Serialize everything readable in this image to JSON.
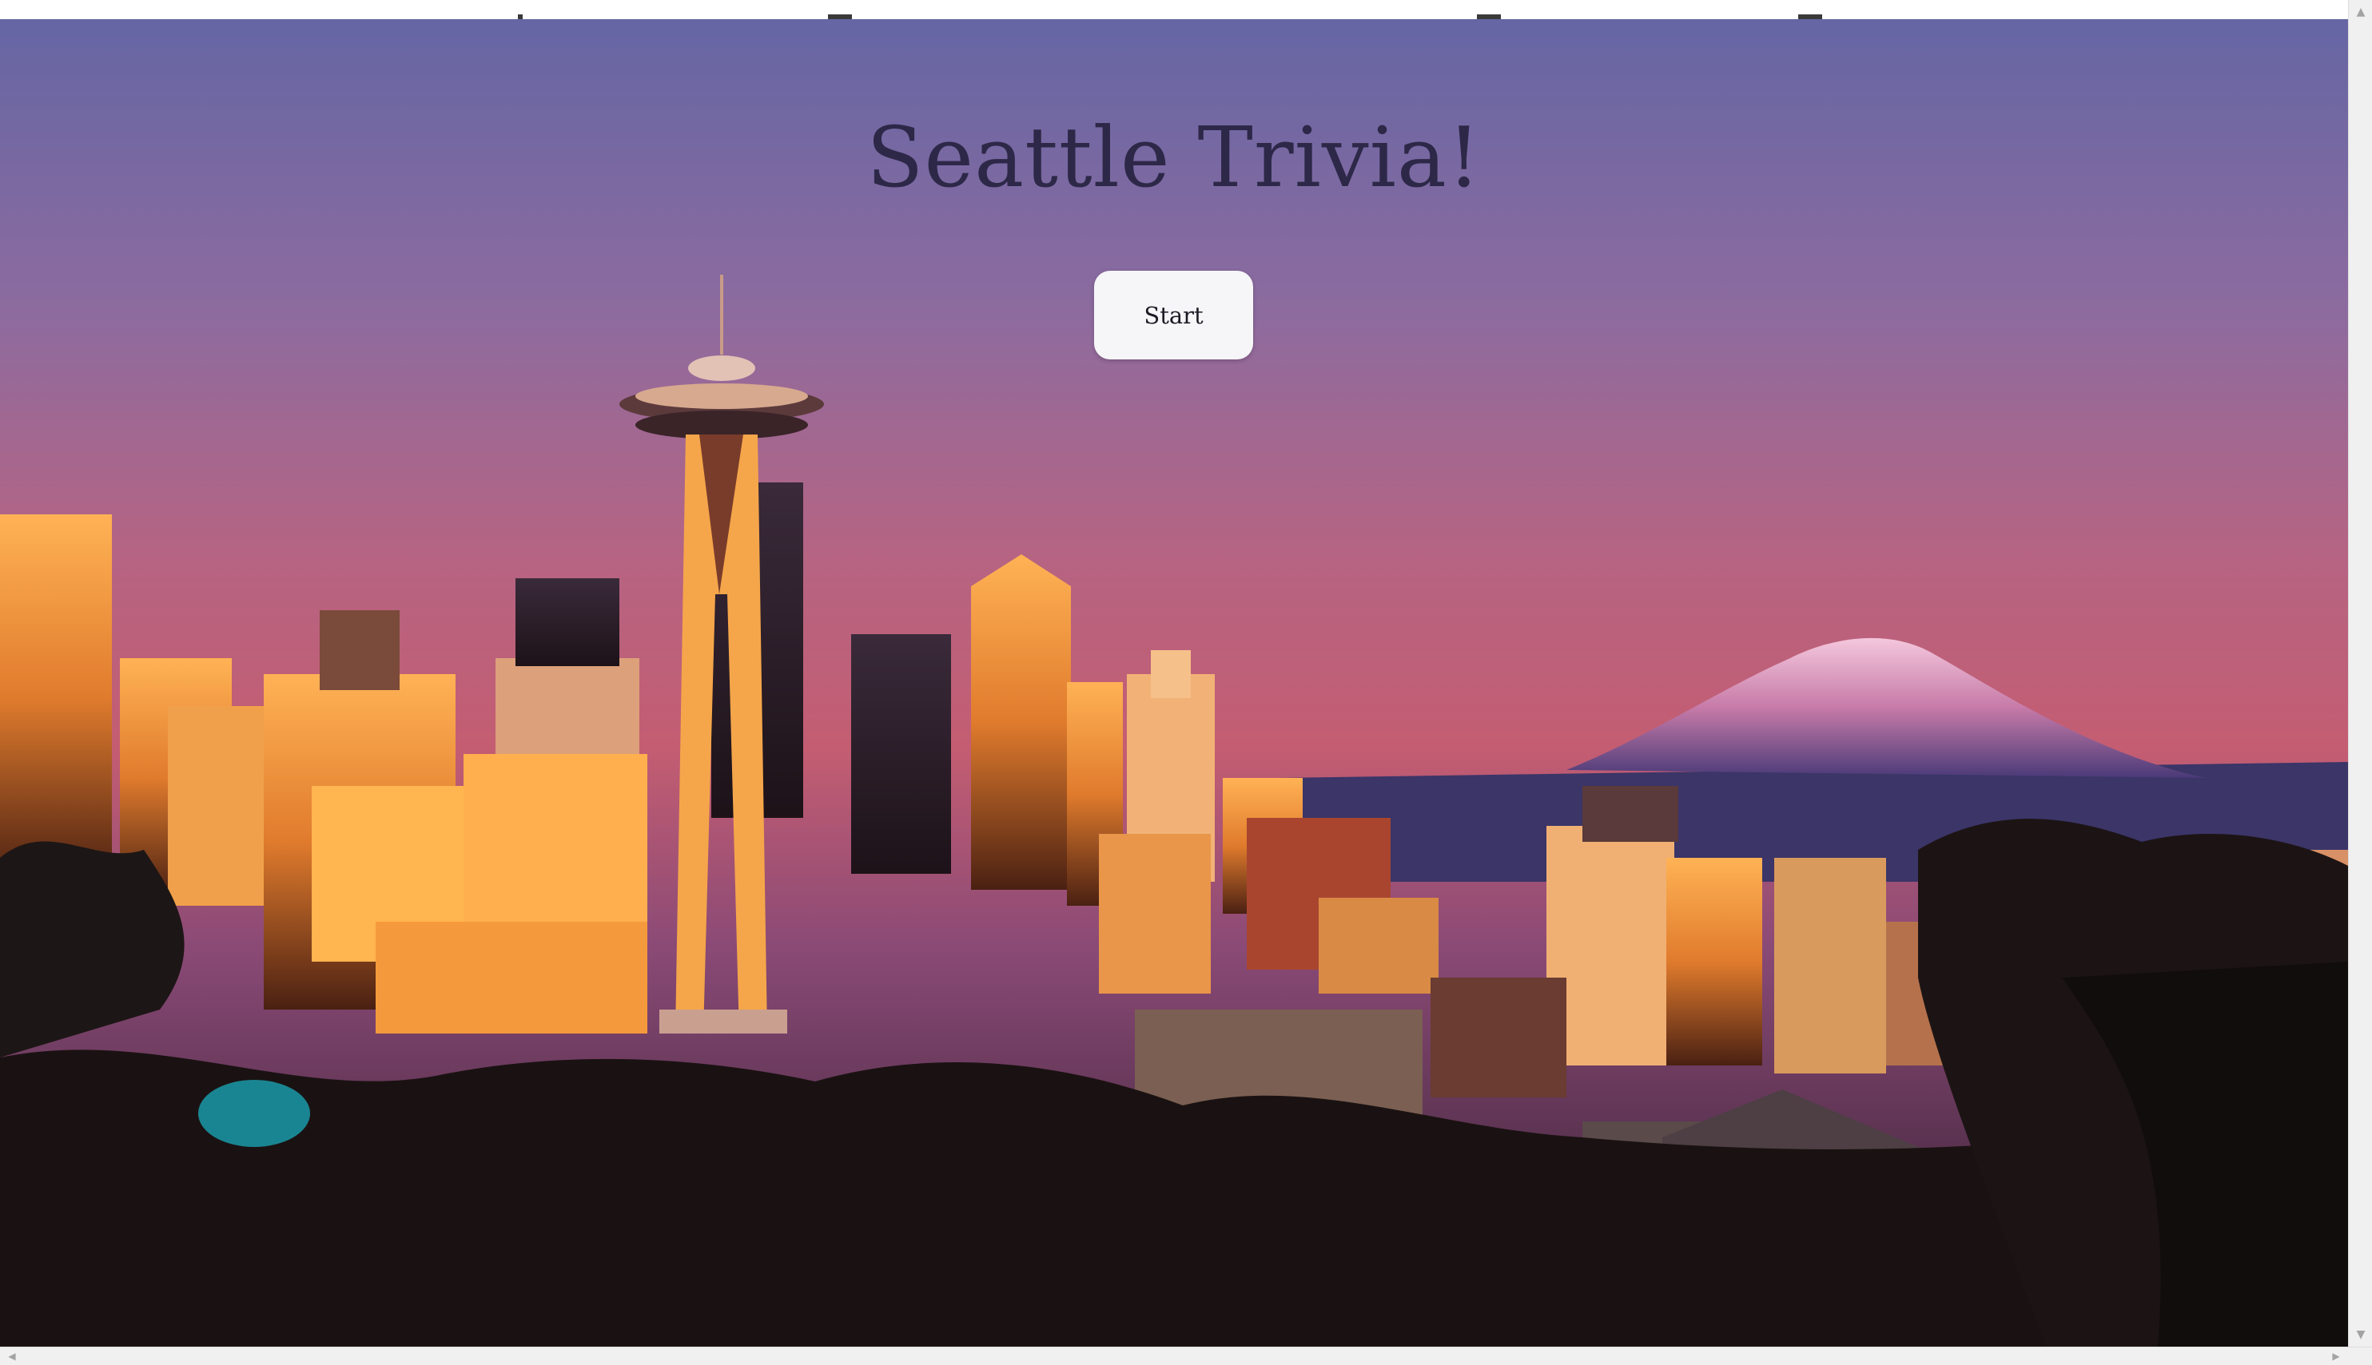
{
  "page": {
    "title": "Seattle Trivia!",
    "start_label": "Start"
  },
  "background": {
    "subject": "Seattle skyline at sunset with Space Needle and Mount Rainier"
  },
  "scrollbars": {
    "up_arrow": "▲",
    "down_arrow": "▼",
    "left_arrow": "◀",
    "right_arrow": "▶"
  },
  "colors": {
    "title": "#2d2848",
    "button_bg": "#f6f6f9",
    "sky_top": "#6b6aa3",
    "sky_mid": "#b5617f",
    "sky_low": "#c65d70"
  }
}
